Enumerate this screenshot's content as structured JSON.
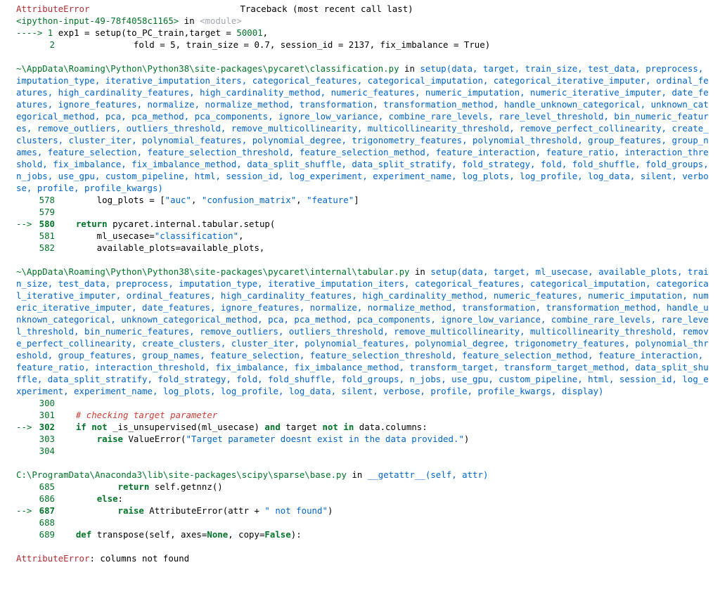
{
  "header": {
    "error_name": "AttributeError",
    "traceback_label": "Traceback (most recent call last)"
  },
  "frame1": {
    "location": "<ipython-input-49-78f4058c1165>",
    "in_word": "in",
    "scope": "<module>",
    "arrow": "---->",
    "line1_num": "1",
    "line1_prefix": "exp1 = setup(to_PC_train,target = ",
    "line1_number": "50001",
    "line1_suffix": ",",
    "line2_num": "2",
    "line2_code": "               fold = 5, train_size = 0.7, session_id = 2137, fix_imbalance = True)"
  },
  "frame2": {
    "path": "~\\AppData\\Roaming\\Python\\Python38\\site-packages\\pycaret\\classification.py",
    "in_word": "in",
    "func": "setup",
    "signature": "(data, target, train_size, test_data, preprocess, imputation_type, iterative_imputation_iters, categorical_features, categorical_imputation, categorical_iterative_imputer, ordinal_features, high_cardinality_features, high_cardinality_method, numeric_features, numeric_imputation, numeric_iterative_imputer, date_features, ignore_features, normalize, normalize_method, transformation, transformation_method, handle_unknown_categorical, unknown_categorical_method, pca, pca_method, pca_components, ignore_low_variance, combine_rare_levels, rare_level_threshold, bin_numeric_features, remove_outliers, outliers_threshold, remove_multicollinearity, multicollinearity_threshold, remove_perfect_collinearity, create_clusters, cluster_iter, polynomial_features, polynomial_degree, trigonometry_features, polynomial_threshold, group_features, group_names, feature_selection, feature_selection_threshold, feature_selection_method, feature_interaction, feature_ratio, interaction_threshold, fix_imbalance, fix_imbalance_method, data_split_shuffle, data_split_stratify, fold_strategy, fold, fold_shuffle, fold_groups, n_jobs, use_gpu, custom_pipeline, html, session_id, log_experiment, experiment_name, log_plots, log_profile, log_data, silent, verbose, profile, profile_kwargs)",
    "l578_num": "578",
    "l578_pre": "        log_plots = [",
    "l578_s1": "\"auc\"",
    "l578_c1": ", ",
    "l578_s2": "\"confusion_matrix\"",
    "l578_c2": ", ",
    "l578_s3": "\"feature\"",
    "l578_end": "]",
    "l579_num": "579",
    "arrow": "-->",
    "l580_num": "580",
    "l580_kw": "return",
    "l580_rest": " pycaret.internal.tabular.setup(",
    "l581_num": "581",
    "l581_pre": "        ml_usecase=",
    "l581_str": "\"classification\"",
    "l581_end": ",",
    "l582_num": "582",
    "l582_code": "        available_plots=available_plots,"
  },
  "frame3": {
    "path": "~\\AppData\\Roaming\\Python\\Python38\\site-packages\\pycaret\\internal\\tabular.py",
    "in_word": "in",
    "func": "setup",
    "signature": "(data, target, ml_usecase, available_plots, train_size, test_data, preprocess, imputation_type, iterative_imputation_iters, categorical_features, categorical_imputation, categorical_iterative_imputer, ordinal_features, high_cardinality_features, high_cardinality_method, numeric_features, numeric_imputation, numeric_iterative_imputer, date_features, ignore_features, normalize, normalize_method, transformation, transformation_method, handle_unknown_categorical, unknown_categorical_method, pca, pca_method, pca_components, ignore_low_variance, combine_rare_levels, rare_level_threshold, bin_numeric_features, remove_outliers, outliers_threshold, remove_multicollinearity, multicollinearity_threshold, remove_perfect_collinearity, create_clusters, cluster_iter, polynomial_features, polynomial_degree, trigonometry_features, polynomial_threshold, group_features, group_names, feature_selection, feature_selection_threshold, feature_selection_method, feature_interaction, feature_ratio, interaction_threshold, fix_imbalance, fix_imbalance_method, transform_target, transform_target_method, data_split_shuffle, data_split_stratify, fold_strategy, fold, fold_shuffle, fold_groups, n_jobs, use_gpu, custom_pipeline, html, session_id, log_experiment, experiment_name, log_plots, log_profile, log_data, silent, verbose, profile, profile_kwargs, display)",
    "l300_num": "300",
    "l301_num": "301",
    "l301_comment": "# checking target parameter",
    "arrow": "-->",
    "l302_num": "302",
    "l302_if": "if",
    "l302_not": "not",
    "l302_mid": " _is_unsupervised(ml_usecase) ",
    "l302_and": "and",
    "l302_target": " target ",
    "l302_not2": "not",
    "l302_in": "in",
    "l302_end": " data.columns:",
    "l303_num": "303",
    "l303_raise": "raise",
    "l303_pre": " ValueError(",
    "l303_str": "\"Target parameter doesnt exist in the data provided.\"",
    "l303_end": ")",
    "l304_num": "304"
  },
  "frame4": {
    "path": "C:\\ProgramData\\Anaconda3\\lib\\site-packages\\scipy\\sparse\\base.py",
    "in_word": "in",
    "func": "__getattr__",
    "signature": "(self, attr)",
    "l685_num": "685",
    "l685_kw": "return",
    "l685_rest": " self.getnnz()",
    "l686_num": "686",
    "l686_kw": "else",
    "l686_rest": ":",
    "arrow": "-->",
    "l687_num": "687",
    "l687_kw": "raise",
    "l687_pre": " AttributeError(attr + ",
    "l687_str": "\" not found\"",
    "l687_end": ")",
    "l688_num": "688",
    "l689_num": "689",
    "l689_kw": "def",
    "l689_rest": " transpose(self, axes=",
    "l689_none": "None",
    "l689_mid": ", copy=",
    "l689_false": "False",
    "l689_end": "):"
  },
  "final": {
    "error_name": "AttributeError",
    "message": ": columns not found"
  }
}
